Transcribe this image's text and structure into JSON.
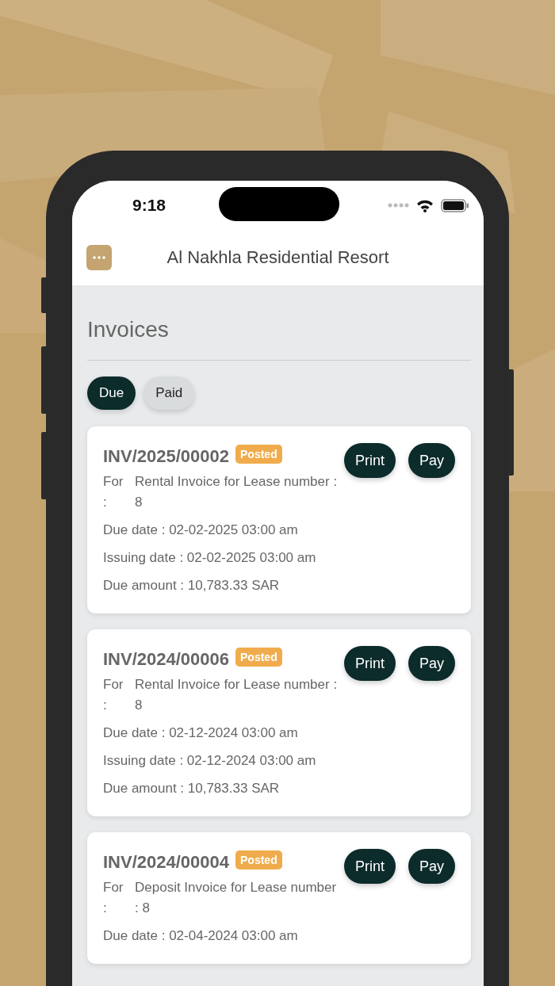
{
  "status_bar": {
    "time": "9:18"
  },
  "header": {
    "title": "Al Nakhla Residential Resort"
  },
  "page_title": "Invoices",
  "filters": [
    {
      "label": "Due",
      "selected": true
    },
    {
      "label": "Paid",
      "selected": false
    }
  ],
  "invoices": [
    {
      "number": "INV/2025/00002",
      "status": "Posted",
      "actions": [
        "Print",
        "Pay"
      ],
      "fields": [
        {
          "kind": "block",
          "label": "For :",
          "value": "Rental Invoice for Lease number : 8"
        },
        {
          "kind": "inline",
          "text": "Due date : 02-02-2025 03:00 am"
        },
        {
          "kind": "inline",
          "text": "Issuing date : 02-02-2025 03:00 am"
        },
        {
          "kind": "inline",
          "text": "Due amount : 10,783.33 SAR"
        }
      ]
    },
    {
      "number": "INV/2024/00006",
      "status": "Posted",
      "actions": [
        "Print",
        "Pay"
      ],
      "fields": [
        {
          "kind": "block",
          "label": "For :",
          "value": "Rental Invoice for Lease number : 8"
        },
        {
          "kind": "inline",
          "text": "Due date : 02-12-2024 03:00 am"
        },
        {
          "kind": "inline",
          "text": "Issuing date : 02-12-2024 03:00 am"
        },
        {
          "kind": "inline",
          "text": "Due amount : 10,783.33 SAR"
        }
      ]
    },
    {
      "number": "INV/2024/00004",
      "status": "Posted",
      "actions": [
        "Print",
        "Pay"
      ],
      "fields": [
        {
          "kind": "block",
          "label": "For :",
          "value": "Deposit Invoice for Lease number : 8"
        },
        {
          "kind": "inline",
          "text": "Due date : 02-04-2024 03:00 am"
        }
      ]
    }
  ]
}
